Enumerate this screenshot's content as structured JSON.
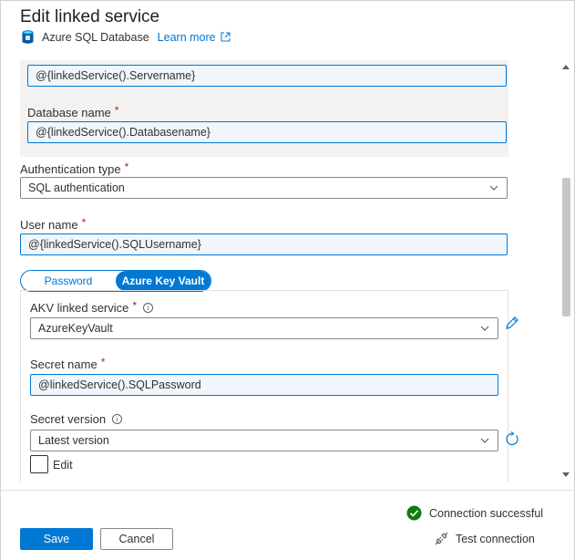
{
  "header": {
    "title": "Edit linked service",
    "service_type": "Azure SQL Database",
    "learn_more": "Learn more"
  },
  "form": {
    "servername_value": "@{linkedService().Servername}",
    "database_name": {
      "label": "Database name",
      "value": "@{linkedService().Databasename}"
    },
    "authentication_type": {
      "label": "Authentication type",
      "value": "SQL authentication"
    },
    "user_name": {
      "label": "User name",
      "value": "@{linkedService().SQLUsername}"
    },
    "password_toggle": {
      "options": [
        "Password",
        "Azure Key Vault"
      ],
      "selected": "Azure Key Vault"
    },
    "akv_linked_service": {
      "label": "AKV linked service",
      "value": "AzureKeyVault"
    },
    "secret_name": {
      "label": "Secret name",
      "value": "@linkedService().SQLPassword"
    },
    "secret_version": {
      "label": "Secret version",
      "value": "Latest version",
      "edit_label": "Edit"
    },
    "required_marker": "*"
  },
  "footer": {
    "status": "Connection successful",
    "test_connection": "Test connection",
    "save": "Save",
    "cancel": "Cancel"
  },
  "colors": {
    "accent": "#0078d4",
    "success": "#107c10",
    "required": "#a4262c"
  }
}
